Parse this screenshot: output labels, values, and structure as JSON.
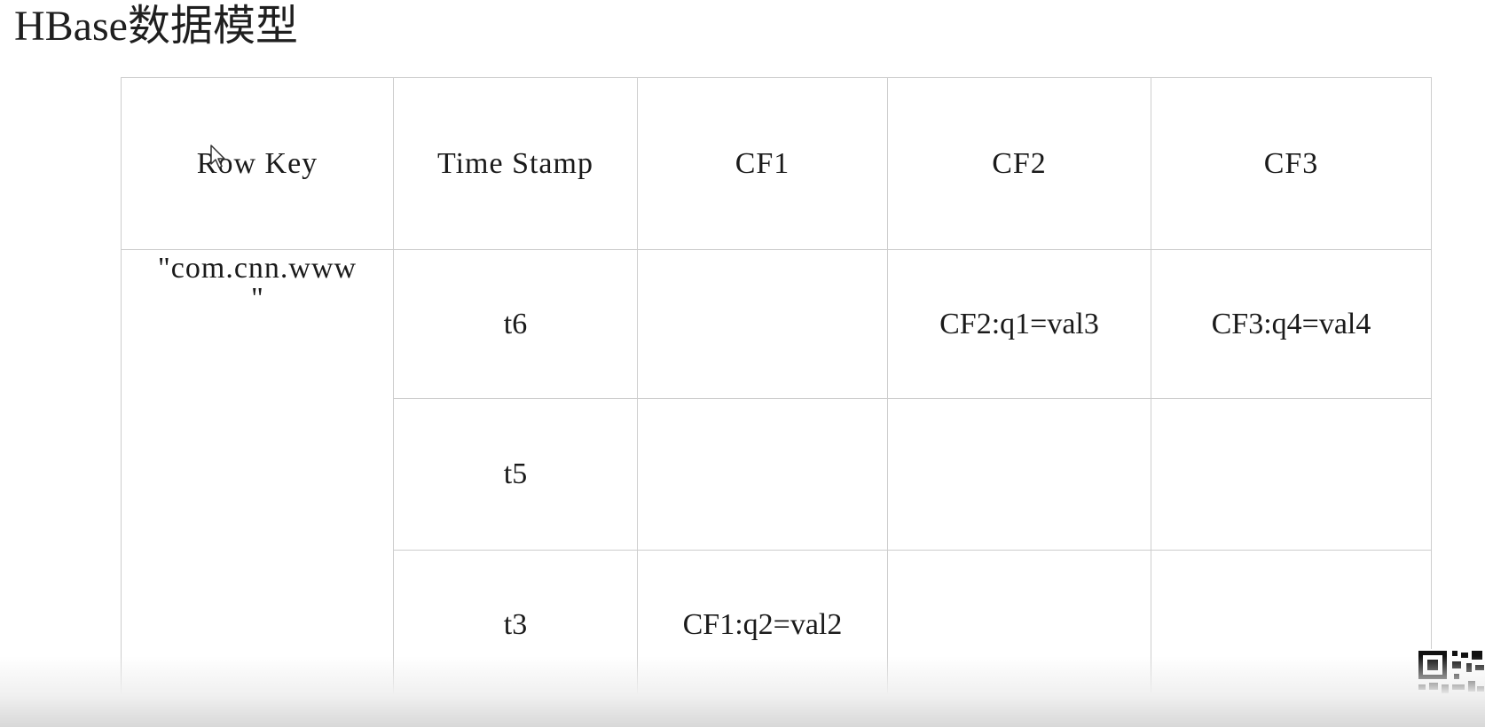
{
  "slide": {
    "title": "HBase数据模型"
  },
  "table": {
    "headers": [
      "Row Key",
      "Time Stamp",
      "CF1",
      "CF2",
      "CF3"
    ],
    "row_key": {
      "line1": "\"com.cnn.www",
      "line2": "\""
    },
    "rows": [
      {
        "timestamp": "t6",
        "cf1": "",
        "cf2": "CF2:q1=val3",
        "cf3": "CF3:q4=val4"
      },
      {
        "timestamp": "t5",
        "cf1": "",
        "cf2": "",
        "cf3": ""
      },
      {
        "timestamp": "t3",
        "cf1": "CF1:q2=val2",
        "cf2": "",
        "cf3": ""
      }
    ]
  },
  "icons": {
    "cursor": "mouse-pointer-icon",
    "qr": "qr-code-icon"
  },
  "colors": {
    "grid": "#cdcdcd",
    "text": "#1a1a1a",
    "background": "#ffffff"
  }
}
